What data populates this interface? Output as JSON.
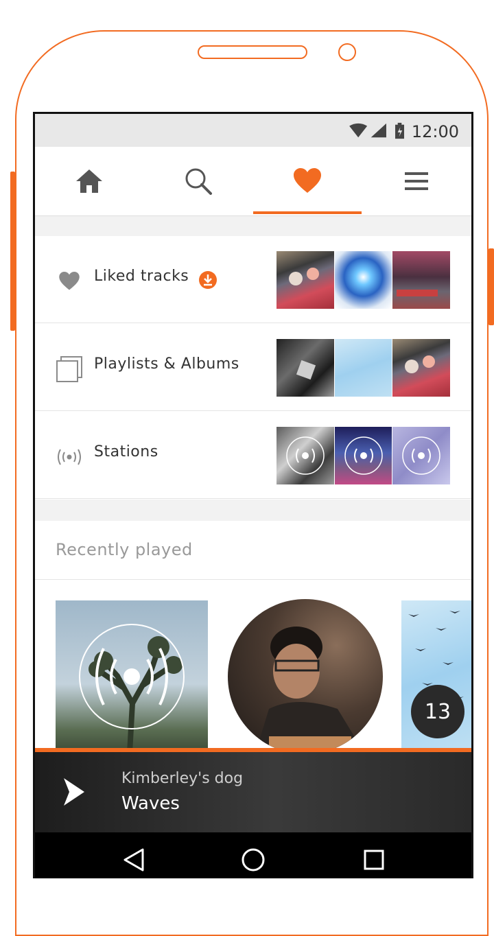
{
  "status_bar": {
    "time": "12:00"
  },
  "tabs": [
    {
      "name": "home",
      "icon": "home-icon"
    },
    {
      "name": "search",
      "icon": "search-icon"
    },
    {
      "name": "likes",
      "icon": "heart-icon",
      "active": true
    },
    {
      "name": "menu",
      "icon": "menu-icon"
    }
  ],
  "collection": [
    {
      "label": "Liked tracks",
      "icon": "heart-icon",
      "badge_icon": "download-icon"
    },
    {
      "label": "Playlists & Albums",
      "icon": "playlist-icon"
    },
    {
      "label": "Stations",
      "icon": "station-icon"
    }
  ],
  "recently_played": {
    "title": "Recently played",
    "count_badge": "13"
  },
  "player": {
    "artist": "Kimberley's dog",
    "title": "Waves"
  },
  "colors": {
    "accent": "#f26b21"
  }
}
